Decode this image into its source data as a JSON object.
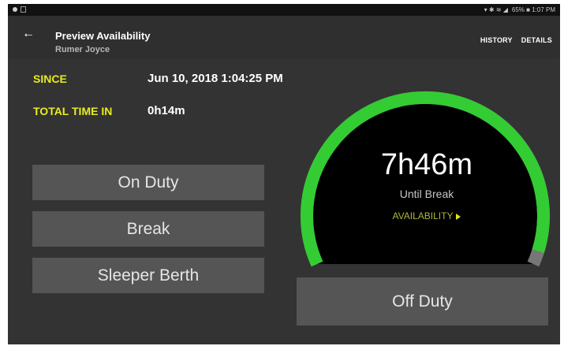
{
  "status_bar": {
    "right_text": "65% ■ 1:07 PM"
  },
  "header": {
    "back_icon": "arrow-left-icon",
    "title": "Preview Availability",
    "subtitle": "Rumer Joyce",
    "actions": [
      "HISTORY",
      "DETAILS"
    ]
  },
  "info": {
    "since_label": "SINCE",
    "since_value": "Jun 10, 2018 1:04:25 PM",
    "total_label": "TOTAL TIME IN",
    "total_value": "0h14m"
  },
  "buttons": {
    "on_duty": "On Duty",
    "break": "Break",
    "sleeper": "Sleeper Berth",
    "off_duty": "Off Duty"
  },
  "gauge": {
    "time": "7h46m",
    "caption": "Until Break",
    "link": "AVAILABILITY",
    "progress_fraction": 0.97,
    "colors": {
      "progress": "#33cc33",
      "remaining": "#777777",
      "inner": "#000000"
    }
  },
  "colors": {
    "accent": "#e8ec1f",
    "background": "#333333",
    "button": "#555555"
  }
}
